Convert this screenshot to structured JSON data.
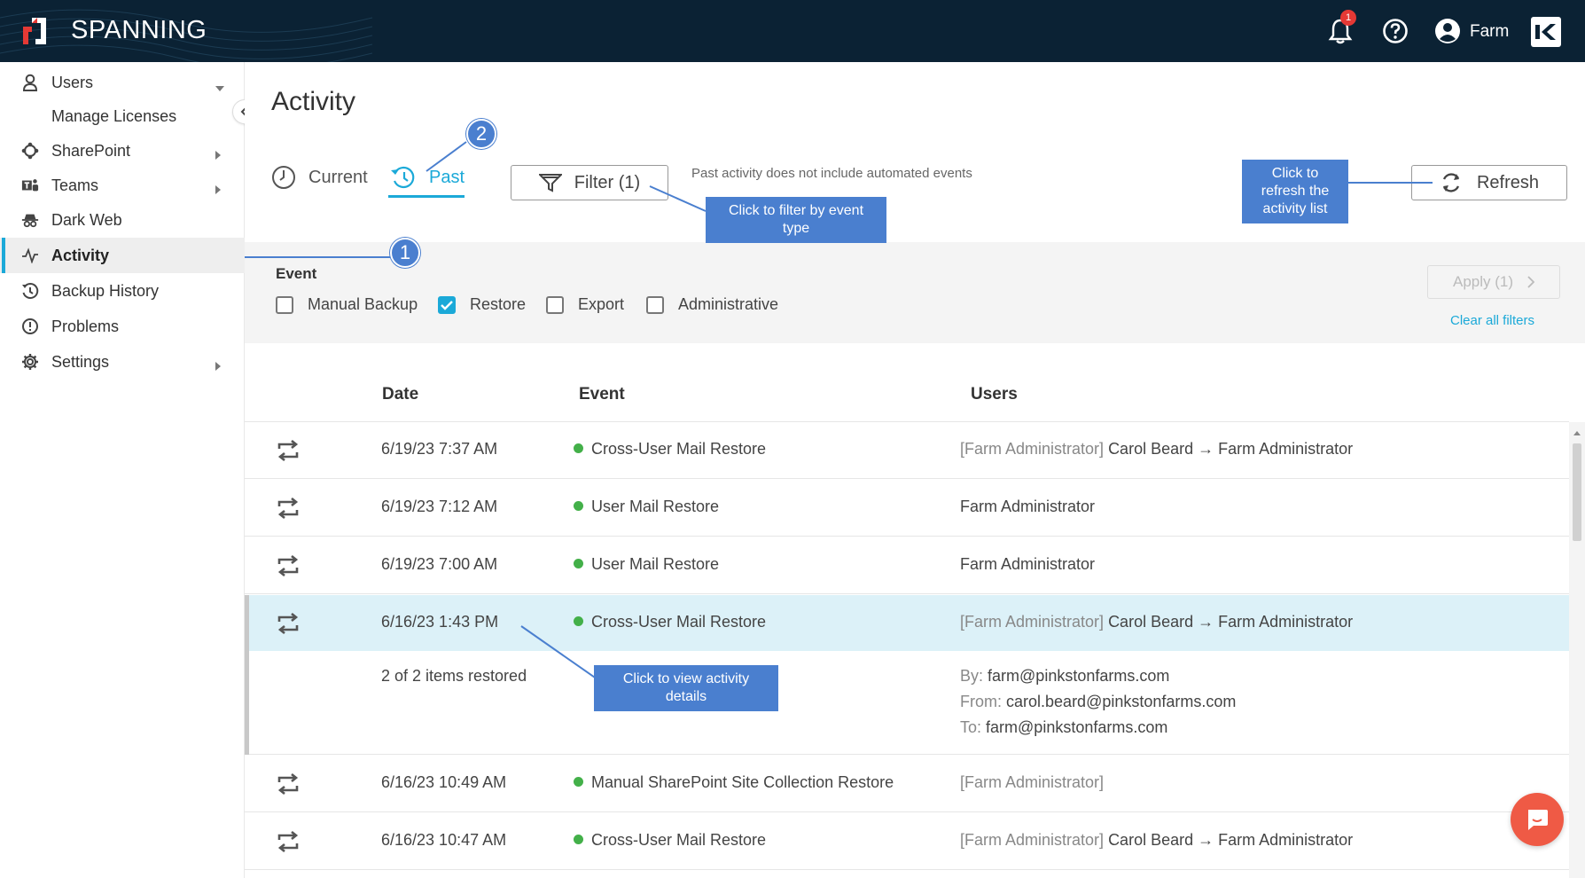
{
  "app": {
    "brand": "SPANNING",
    "notification_count": "1",
    "user_name": "Farm"
  },
  "sidebar": {
    "items": [
      {
        "label": "Users"
      },
      {
        "label": "Manage Licenses"
      },
      {
        "label": "SharePoint"
      },
      {
        "label": "Teams"
      },
      {
        "label": "Dark Web"
      },
      {
        "label": "Activity"
      },
      {
        "label": "Backup History"
      },
      {
        "label": "Problems"
      },
      {
        "label": "Settings"
      }
    ]
  },
  "page": {
    "title": "Activity",
    "tabs": {
      "current": "Current",
      "past": "Past"
    },
    "filter_label": "Filter (1)",
    "past_note": "Past activity does not include automated events",
    "refresh_label": "Refresh"
  },
  "callouts": {
    "filter": "Click to filter by event type",
    "refresh": "Click to refresh the activity list",
    "details": "Click to view activity details",
    "step1": "1",
    "step2": "2"
  },
  "filter_panel": {
    "heading": "Event",
    "options": [
      {
        "label": "Manual Backup",
        "checked": false
      },
      {
        "label": "Restore",
        "checked": true
      },
      {
        "label": "Export",
        "checked": false
      },
      {
        "label": "Administrative",
        "checked": false
      }
    ],
    "apply_label": "Apply (1)",
    "clear_label": "Clear all filters"
  },
  "table": {
    "headers": {
      "date": "Date",
      "event": "Event",
      "users": "Users"
    },
    "rows": [
      {
        "date": "6/19/23 7:37 AM",
        "event": "Cross-User Mail Restore",
        "users_prefix": "[Farm Administrator]",
        "users": "Carol Beard → Farm Administrator"
      },
      {
        "date": "6/19/23 7:12 AM",
        "event": "User Mail Restore",
        "users_prefix": "",
        "users": "Farm Administrator"
      },
      {
        "date": "6/19/23 7:00 AM",
        "event": "User Mail Restore",
        "users_prefix": "",
        "users": "Farm Administrator"
      },
      {
        "date": "6/16/23 1:43 PM",
        "event": "Cross-User Mail Restore",
        "users_prefix": "[Farm Administrator]",
        "users": "Carol Beard → Farm Administrator"
      },
      {
        "date": "6/16/23 10:49 AM",
        "event": "Manual SharePoint Site Collection Restore",
        "users_prefix": "[Farm Administrator]",
        "users": ""
      },
      {
        "date": "6/16/23 10:47 AM",
        "event": "Cross-User Mail Restore",
        "users_prefix": "[Farm Administrator]",
        "users": "Carol Beard → Farm Administrator"
      }
    ],
    "detail": {
      "summary": "2 of 2 items restored",
      "by_label": "By:",
      "by": "farm@pinkstonfarms.com",
      "from_label": "From:",
      "from": "carol.beard@pinkstonfarms.com",
      "to_label": "To:",
      "to": "farm@pinkstonfarms.com"
    }
  },
  "colors": {
    "topbar": "#0b2234",
    "accent": "#1ba9d8",
    "callout": "#4a7fcf",
    "status_green": "#43b049",
    "chat": "#ef5a45"
  }
}
